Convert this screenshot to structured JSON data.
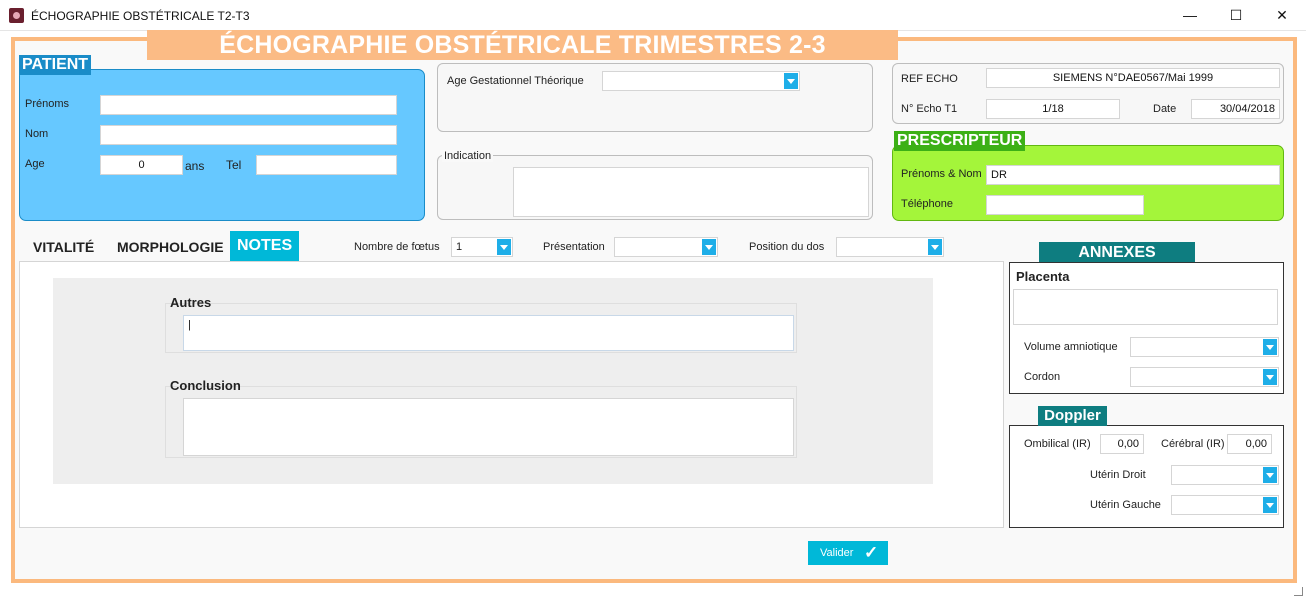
{
  "window": {
    "title": "ÉCHOGRAPHIE OBSTÉTRICALE T2-T3",
    "minimize": "—",
    "maximize": "☐",
    "close": "✕"
  },
  "banner": "ÉCHOGRAPHIE OBSTÉTRICALE TRIMESTRES 2-3",
  "patient": {
    "title": "PATIENT",
    "prenoms_label": "Prénoms",
    "prenoms_value": "",
    "nom_label": "Nom",
    "nom_value": "",
    "age_label": "Age",
    "age_value": "0",
    "age_unit": "ans",
    "tel_label": "Tel",
    "tel_value": ""
  },
  "age_gestationnel": {
    "label": "Age Gestationnel Théorique",
    "value": ""
  },
  "indication": {
    "label": "Indication",
    "value": ""
  },
  "echo": {
    "ref_label": "REF ECHO",
    "ref_value": "SIEMENS N°DAE0567/Mai 1999",
    "num_label": "N° Echo T1",
    "num_value": "1/18",
    "date_label": "Date",
    "date_value": "30/04/2018"
  },
  "prescripteur": {
    "title": "PRESCRIPTEUR",
    "nom_label": "Prénoms & Nom",
    "nom_value": "DR",
    "tel_label": "Téléphone",
    "tel_value": ""
  },
  "tabs": [
    {
      "label": "VITALITÉ"
    },
    {
      "label": "MORPHOLOGIE"
    },
    {
      "label": "NOTES"
    }
  ],
  "toolbar": {
    "foetus_label": "Nombre de fœtus",
    "foetus_value": "1",
    "presentation_label": "Présentation",
    "presentation_value": "",
    "dos_label": "Position du dos",
    "dos_value": ""
  },
  "notes": {
    "autres_label": "Autres",
    "autres_value": "|",
    "conclusion_label": "Conclusion",
    "conclusion_value": ""
  },
  "annexes": {
    "title": "ANNEXES",
    "placenta_label": "Placenta",
    "placenta_value": "",
    "volume_label": "Volume amniotique",
    "volume_value": "",
    "cordon_label": "Cordon",
    "cordon_value": ""
  },
  "doppler": {
    "title": "Doppler",
    "ombilical_label": "Ombilical (IR)",
    "ombilical_value": "0,00",
    "cerebral_label": "Cérébral (IR)",
    "cerebral_value": "0,00",
    "uterin_droit_label": "Utérin Droit",
    "uterin_droit_value": "",
    "uterin_gauche_label": "Utérin Gauche",
    "uterin_gauche_value": ""
  },
  "valider": {
    "label": "Valider",
    "icon": "✓"
  },
  "colors": {
    "banner": "#fbbb85",
    "patient_panel": "#66c8ff",
    "patient_tag": "#1a8cc8",
    "prescripteur_panel": "#a4f53a",
    "prescripteur_tag": "#3cb016",
    "accent": "#00b8d8",
    "annexes_tag": "#0e7d80"
  }
}
